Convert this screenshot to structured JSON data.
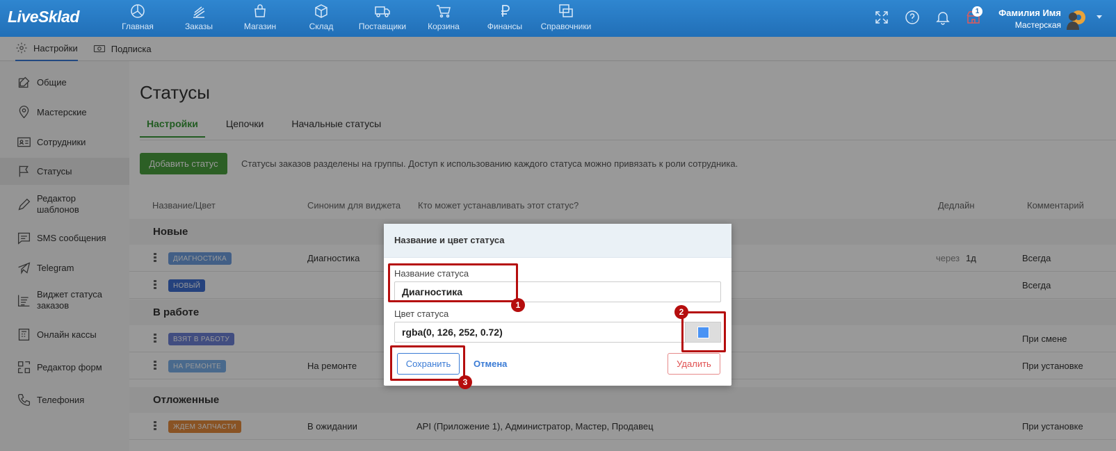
{
  "app": {
    "logo": "LiveSklad"
  },
  "nav": [
    {
      "label": "Главная",
      "icon": "dashboard-icon"
    },
    {
      "label": "Заказы",
      "icon": "orders-icon"
    },
    {
      "label": "Магазин",
      "icon": "shop-icon"
    },
    {
      "label": "Склад",
      "icon": "box-icon"
    },
    {
      "label": "Поставщики",
      "icon": "truck-icon"
    },
    {
      "label": "Корзина",
      "icon": "cart-icon"
    },
    {
      "label": "Финансы",
      "icon": "ruble-icon"
    },
    {
      "label": "Справочники",
      "icon": "reference-icon"
    }
  ],
  "header": {
    "notifications_badge": "1",
    "user_name": "Фамилия Имя",
    "user_role": "Мастерская"
  },
  "subbar": {
    "settings_label": "Настройки",
    "subscription_label": "Подписка"
  },
  "sidebar": [
    {
      "label": "Общие"
    },
    {
      "label": "Мастерские"
    },
    {
      "label": "Сотрудники"
    },
    {
      "label": "Статусы"
    },
    {
      "label": "Редактор шаблонов"
    },
    {
      "label": "SMS сообщения"
    },
    {
      "label": "Telegram"
    },
    {
      "label": "Виджет статуса заказов"
    },
    {
      "label": "Онлайн кассы"
    },
    {
      "label": "Редактор форм"
    },
    {
      "label": "Телефония"
    }
  ],
  "page": {
    "title": "Статусы",
    "tabs": [
      "Настройки",
      "Цепочки",
      "Начальные статусы"
    ],
    "add_button": "Добавить статус",
    "hint": "Статусы заказов разделены на группы. Доступ к использованию каждого статуса можно привязать к роли сотрудника."
  },
  "table": {
    "headers": [
      "Название/Цвет",
      "Синоним для виджета",
      "Кто может устанавливать этот статус?",
      "Дедлайн",
      "Комментарий"
    ],
    "groups": [
      {
        "title": "Новые"
      },
      {
        "title": "В работе"
      },
      {
        "title": "Отложенные"
      }
    ],
    "rows": [
      {
        "tag": "ДИАГНОСТИКА",
        "color": "#6e9fe0",
        "synonym": "Диагностика",
        "who": "",
        "dl1": "через",
        "dl2": "1д",
        "comment": "Всегда"
      },
      {
        "tag": "НОВЫЙ",
        "color": "#3f6fd0",
        "synonym": "",
        "who": "",
        "dl1": "",
        "dl2": "",
        "comment": "Всегда"
      },
      {
        "tag": "ВЗЯТ В РАБОТУ",
        "color": "#6d80d6",
        "synonym": "",
        "who": "",
        "dl1": "",
        "dl2": "",
        "comment": "При смене"
      },
      {
        "tag": "НА РЕМОНТЕ",
        "color": "#7ab0ea",
        "synonym": "На ремонте",
        "who": "",
        "dl1": "",
        "dl2": "",
        "comment": "При установке"
      },
      {
        "tag": "ЖДЕМ ЗАПЧАСТИ",
        "color": "#e48a3c",
        "synonym": "В ожидании",
        "who": "API (Приложение 1), Администратор, Мастер, Продавец",
        "dl1": "",
        "dl2": "",
        "comment": "При установке"
      }
    ]
  },
  "modal": {
    "title": "Название и цвет статуса",
    "name_label": "Название статуса",
    "name_value": "Диагностика",
    "color_label": "Цвет статуса",
    "color_value": "rgba(0, 126, 252, 0.72)",
    "swatch_color": "#4a93f4",
    "save": "Сохранить",
    "cancel": "Отмена",
    "delete": "Удалить"
  },
  "markers": [
    "1",
    "2",
    "3"
  ]
}
